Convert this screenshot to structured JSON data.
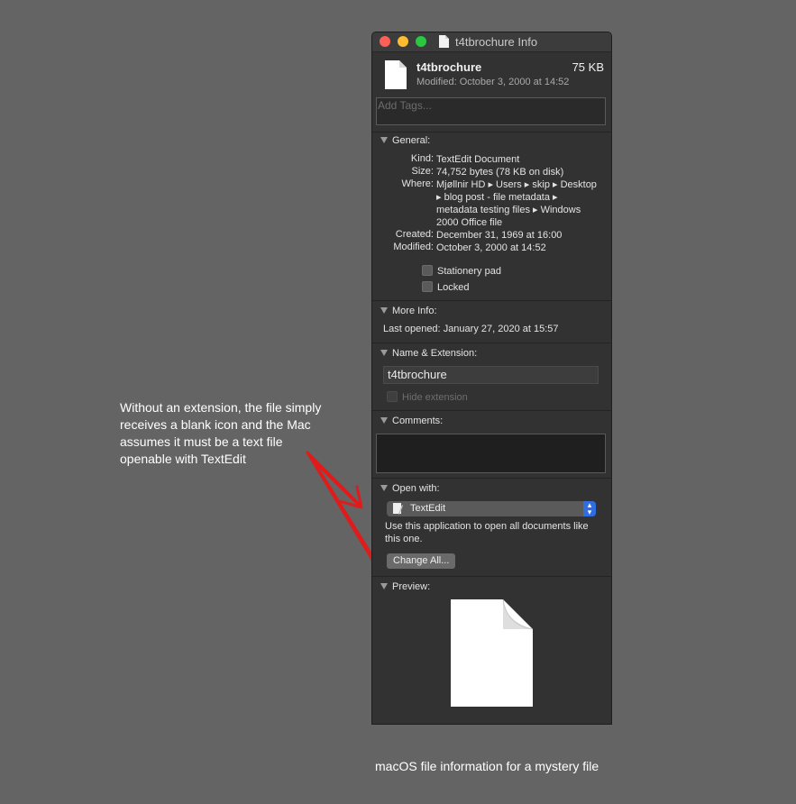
{
  "annotation": {
    "text": "Without  an extension, the file simply\nreceives a blank icon and the Mac\nassumes it must be a text file\nopenable with TextEdit"
  },
  "caption": "macOS file information for a mystery file",
  "window": {
    "title": "t4tbrochure Info",
    "file_name": "t4tbrochure",
    "file_size": "75 KB",
    "modified_line": "Modified: October 3, 2000 at 14:52",
    "tags_placeholder": "Add Tags..."
  },
  "general": {
    "heading": "General:",
    "rows": [
      {
        "label": "Kind:",
        "value": "TextEdit Document"
      },
      {
        "label": "Size:",
        "value": "74,752 bytes (78 KB on disk)"
      },
      {
        "label": "Where:",
        "value": "Mjøllnir HD ▸ Users ▸ skip ▸ Desktop ▸ blog post - file metadata ▸ metadata testing files ▸ Windows 2000 Office file"
      },
      {
        "label": "Created:",
        "value": "December 31, 1969 at 16:00"
      },
      {
        "label": "Modified:",
        "value": "October 3, 2000 at 14:52"
      }
    ],
    "stationery_label": "Stationery pad",
    "locked_label": "Locked"
  },
  "more_info": {
    "heading": "More Info:",
    "last_opened_label": "Last opened:",
    "last_opened_value": "January 27, 2020 at 15:57"
  },
  "name_extension": {
    "heading": "Name & Extension:",
    "name_value": "t4tbrochure",
    "hide_extension_label": "Hide extension"
  },
  "comments": {
    "heading": "Comments:"
  },
  "open_with": {
    "heading": "Open with:",
    "app": "TextEdit",
    "description": "Use this application to open all documents like this one.",
    "change_all_label": "Change All..."
  },
  "preview": {
    "heading": "Preview:"
  },
  "colors": {
    "arrow": "#e01b1b",
    "window_bg": "#323232",
    "stepper": "#2f6de0"
  }
}
